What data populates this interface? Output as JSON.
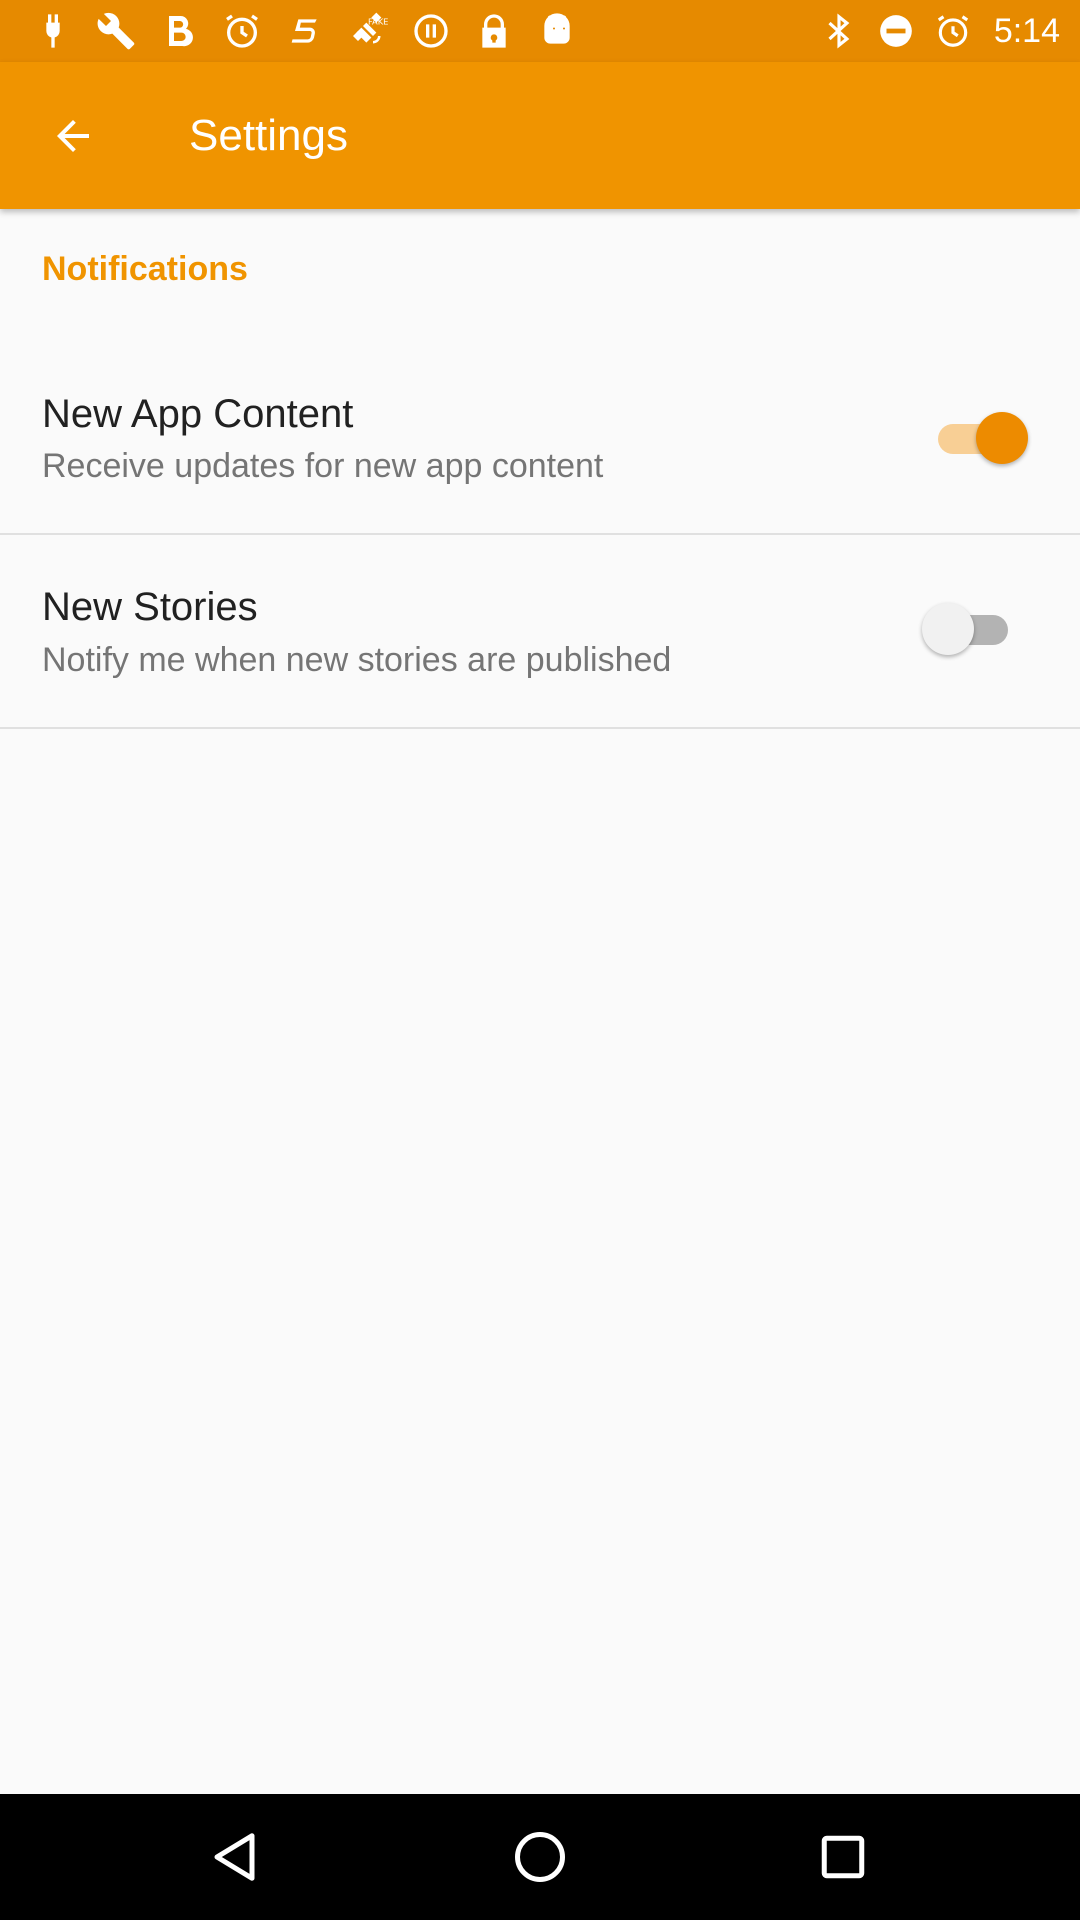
{
  "status_bar": {
    "time": "5:14",
    "left_icons": [
      "plug-icon",
      "wrench-icon",
      "bold-b-icon",
      "alarm-icon",
      "swipe-s-icon",
      "fake-gps-satellite-icon",
      "pause-circle-icon",
      "lock-icon",
      "android-robot-icon"
    ],
    "right_icons": [
      "bluetooth-icon",
      "do-not-disturb-icon",
      "alarm-icon"
    ]
  },
  "app_bar": {
    "title": "Settings",
    "back_icon": "arrow-back-icon"
  },
  "section": {
    "header": "Notifications"
  },
  "preferences": [
    {
      "title": "New App Content",
      "summary": "Receive updates for new app content",
      "enabled": true
    },
    {
      "title": "New Stories",
      "summary": "Notify me when new stories are published",
      "enabled": false
    }
  ],
  "nav_bar": {
    "buttons": [
      "back-triangle-icon",
      "home-circle-icon",
      "recents-square-icon"
    ]
  },
  "colors": {
    "status_bar": "#e68a00",
    "app_bar": "#f09400",
    "accent": "#f09400",
    "switch_on_thumb": "#ed8b00",
    "switch_on_track": "#f8cf95",
    "background": "#fafafa"
  }
}
